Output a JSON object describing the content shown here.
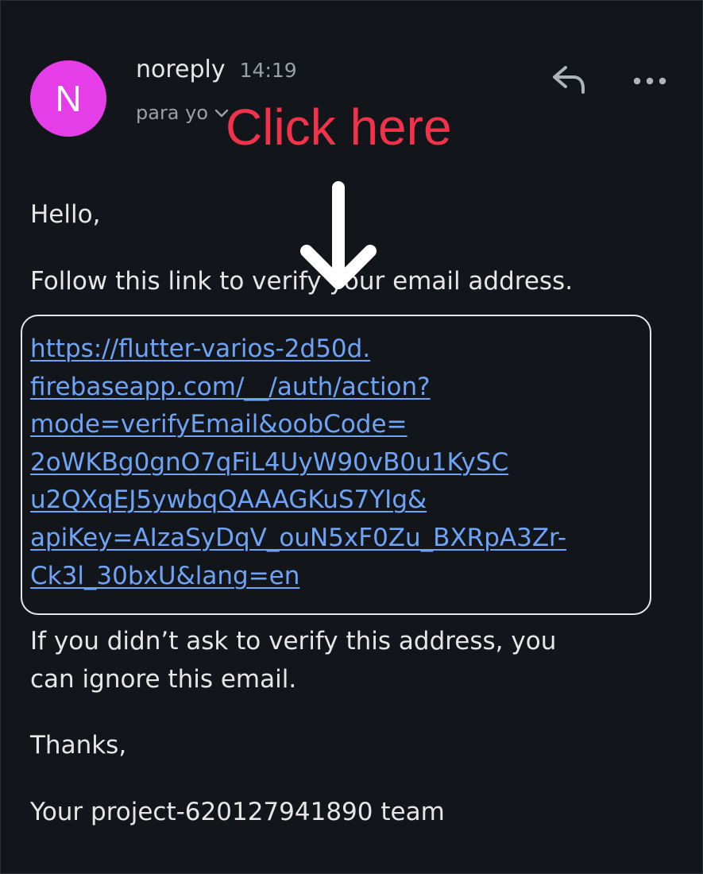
{
  "header": {
    "avatar_letter": "N",
    "sender": "noreply",
    "time": "14:19",
    "recipient": "para yo",
    "reply_icon": "reply-icon",
    "more_icon": "more-horizontal-icon"
  },
  "annotation": {
    "callout": "Click here",
    "arrow_icon": "arrow-down-icon",
    "callout_color": "#f2324a"
  },
  "body": {
    "greeting": "Hello,",
    "instruction": "Follow this link to verify your email address.",
    "link_lines": [
      "https://flutter-varios-2d50d.",
      "firebaseapp.com/__/auth/action?",
      "mode=verifyEmail&oobCode=",
      "2oWKBg0gnO7qFiL4UyW90vB0u1KySC",
      "u2QXqEJ5ywbqQAAAGKuS7YIg&",
      "apiKey=AIzaSyDqV_ouN5xF0Zu_BXRpA3Zr-",
      "Ck3l_30bxU&lang=en"
    ],
    "ignore_line1": "If you didn’t ask to verify this address, you",
    "ignore_line2": "can ignore this email.",
    "thanks": "Thanks,",
    "signoff": "Your project-620127941890 team"
  },
  "colors": {
    "background": "#12161b",
    "avatar": "#e53ee8",
    "link": "#6ea3f5"
  }
}
